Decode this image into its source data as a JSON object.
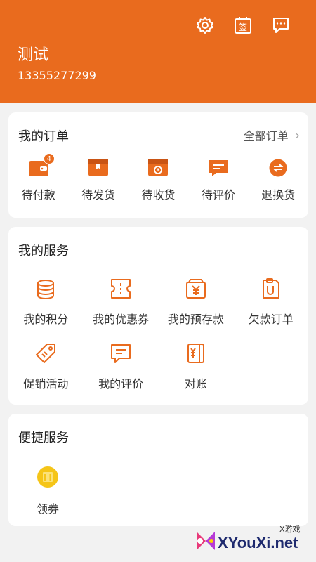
{
  "header": {
    "user_name": "测试",
    "phone": "13355277299",
    "icons": [
      "gear-icon",
      "sign-in-calendar-icon",
      "message-icon"
    ],
    "sign_icon_char": "签",
    "bg_color": "#e96b1e"
  },
  "orders": {
    "title": "我的订单",
    "all_label": "全部订单",
    "chevron": "›",
    "items": [
      {
        "label": "待付款",
        "icon": "wallet-icon",
        "badge": "4"
      },
      {
        "label": "待发货",
        "icon": "package-icon"
      },
      {
        "label": "待收货",
        "icon": "delivery-box-icon"
      },
      {
        "label": "待评价",
        "icon": "comment-icon"
      },
      {
        "label": "退换货",
        "icon": "exchange-icon"
      }
    ]
  },
  "services": {
    "title": "我的服务",
    "items": [
      {
        "label": "我的积分",
        "icon": "coins-icon"
      },
      {
        "label": "我的优惠券",
        "icon": "coupon-icon"
      },
      {
        "label": "我的预存款",
        "icon": "deposit-icon"
      },
      {
        "label": "欠款订单",
        "icon": "debt-order-icon"
      },
      {
        "label": "促销活动",
        "icon": "tag-icon"
      },
      {
        "label": "我的评价",
        "icon": "review-icon"
      },
      {
        "label": "对账",
        "icon": "ledger-icon"
      }
    ]
  },
  "quick": {
    "title": "便捷服务",
    "items": [
      {
        "label": "领券",
        "icon": "get-coupon-icon"
      }
    ]
  },
  "watermark": {
    "small": "X游戏",
    "big": "XYouXi.net"
  },
  "colors": {
    "accent": "#e96b1e",
    "coupon_yellow": "#f5c518"
  }
}
